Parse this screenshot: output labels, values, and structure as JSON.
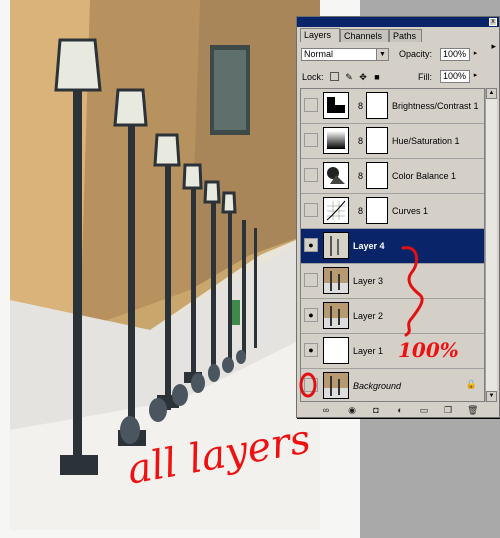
{
  "panel": {
    "tabs": [
      "Layers",
      "Channels",
      "Paths"
    ],
    "close_glyph": "x",
    "menu_glyph": "▸",
    "blend_mode": "Normal",
    "opacity_label": "Opacity:",
    "opacity_value": "100%",
    "lock_label": "Lock:",
    "fill_label": "Fill:",
    "fill_value": "100%"
  },
  "layers": [
    {
      "name": "Brightness/Contrast 1",
      "visible": false,
      "type": "adjustment",
      "selected": false
    },
    {
      "name": "Hue/Saturation 1",
      "visible": false,
      "type": "adjustment",
      "selected": false
    },
    {
      "name": "Color Balance 1",
      "visible": false,
      "type": "adjustment",
      "selected": false
    },
    {
      "name": "Curves 1",
      "visible": false,
      "type": "adjustment",
      "selected": false
    },
    {
      "name": "Layer 4",
      "visible": true,
      "type": "image",
      "selected": true
    },
    {
      "name": "Layer 3",
      "visible": false,
      "type": "image",
      "selected": false
    },
    {
      "name": "Layer 2",
      "visible": true,
      "type": "image",
      "selected": false
    },
    {
      "name": "Layer 1",
      "visible": true,
      "type": "white",
      "selected": false
    },
    {
      "name": "Background",
      "visible": false,
      "type": "image",
      "selected": false,
      "locked": true
    }
  ],
  "annotations": {
    "percent": "100%",
    "bottom": "all layers"
  },
  "colors": {
    "selected_row": "#0a246a",
    "annotation": "#e11111",
    "panel_bg": "#d4d0c8"
  }
}
